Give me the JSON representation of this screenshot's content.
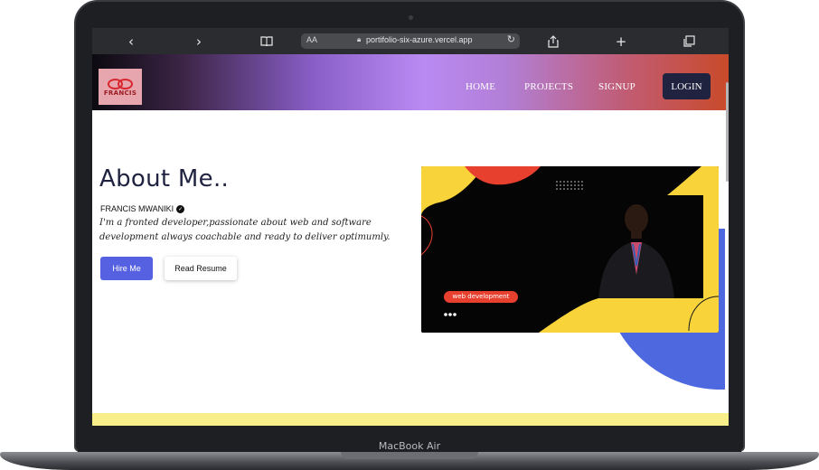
{
  "device": {
    "model_label": "MacBook Air"
  },
  "browser": {
    "text_size_label": "AA",
    "url": "portifolio-six-azure.vercel.app",
    "icons": [
      "chevron-left-icon",
      "chevron-right-icon",
      "book-icon",
      "lock-icon",
      "reload-icon",
      "share-icon",
      "plus-icon",
      "tabs-icon"
    ]
  },
  "site": {
    "logo_text": "FRANCIS",
    "nav": {
      "home": "HOME",
      "projects": "PROJECTS",
      "signup": "SIGNUP",
      "login": "LOGIN"
    }
  },
  "about": {
    "title": "About Me..",
    "author": "FRANCIS MWANIKI",
    "bio": "I'm a fronted developer,passionate about web and software development always coachable and ready to deliver optimumly.",
    "hire_label": "Hire Me",
    "resume_label": "Read Resume"
  },
  "hero": {
    "badge": "web development"
  },
  "colors": {
    "accent": "#5561e0",
    "navy": "#1f2340",
    "yellow": "#f8d33a",
    "red": "#e8402f",
    "blue": "#4e68e0"
  }
}
